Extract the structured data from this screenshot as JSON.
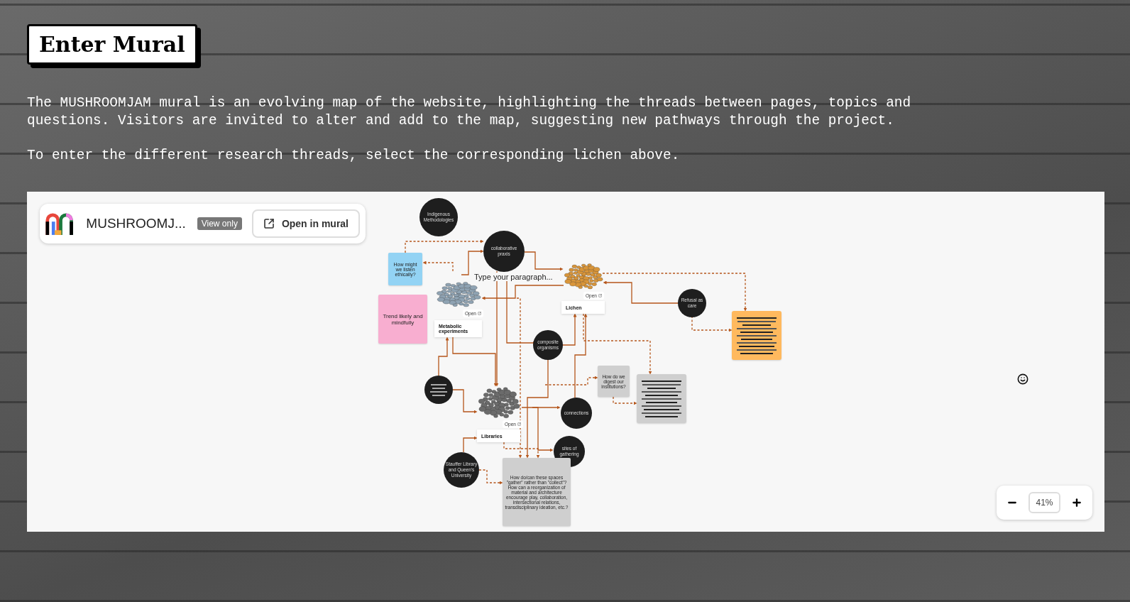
{
  "title": "Enter Mural",
  "intro": [
    "The MUSHROOMJAM mural is an evolving map of the website, highlighting the threads between pages, topics and questions. Visitors are invited to alter and add to the map, suggesting new pathways through the project.",
    "To enter the different research threads, select the corresponding lichen above."
  ],
  "mural": {
    "header": {
      "name": "MUSHROOMJ...",
      "badge": "View only",
      "open_button": "Open in mural"
    },
    "nodes": [
      {
        "kind": "circle",
        "text": "Indigenous Methodologies"
      },
      {
        "kind": "sticky",
        "text": "How might we listen ethically?",
        "color": "#93d3f4"
      },
      {
        "kind": "circle",
        "text": "collaborative praxis"
      },
      {
        "kind": "text",
        "text": "Type your paragraph..."
      },
      {
        "kind": "lichen",
        "label": "Lichen",
        "open": "Open",
        "color": "#d8953a"
      },
      {
        "kind": "sticky",
        "text": "Trend likely and mindfully",
        "color": "#f8aed0"
      },
      {
        "kind": "lichen",
        "label": "Metabolic experiments",
        "open": "Open",
        "color": "#8fa3b3"
      },
      {
        "kind": "circle",
        "text": "Refusal as care"
      },
      {
        "kind": "lines-note",
        "color": "#ffb95e"
      },
      {
        "kind": "circle",
        "text": "composite organisms"
      },
      {
        "kind": "sticky",
        "text": "How do we digest our institutions?",
        "color": "#cfcfcf"
      },
      {
        "kind": "lines-circle"
      },
      {
        "kind": "lines-note",
        "color": "#cfcfcf"
      },
      {
        "kind": "lichen",
        "label": "Libraries",
        "open": "Open",
        "color": "#6b6b6b"
      },
      {
        "kind": "circle",
        "text": "connections"
      },
      {
        "kind": "circle",
        "text": "sites of gathering"
      },
      {
        "kind": "circle",
        "text": "Stauffer Library and Queen's University"
      },
      {
        "kind": "sticky",
        "text": "How do/can these spaces \"gather\" rather than \"collect\"? How can a reorganization of material and architecture encourage play, collaboration, intersectional relations, transdisciplinary ideation, etc.?",
        "color": "#cfcfcf"
      }
    ],
    "zoom": "41%"
  }
}
